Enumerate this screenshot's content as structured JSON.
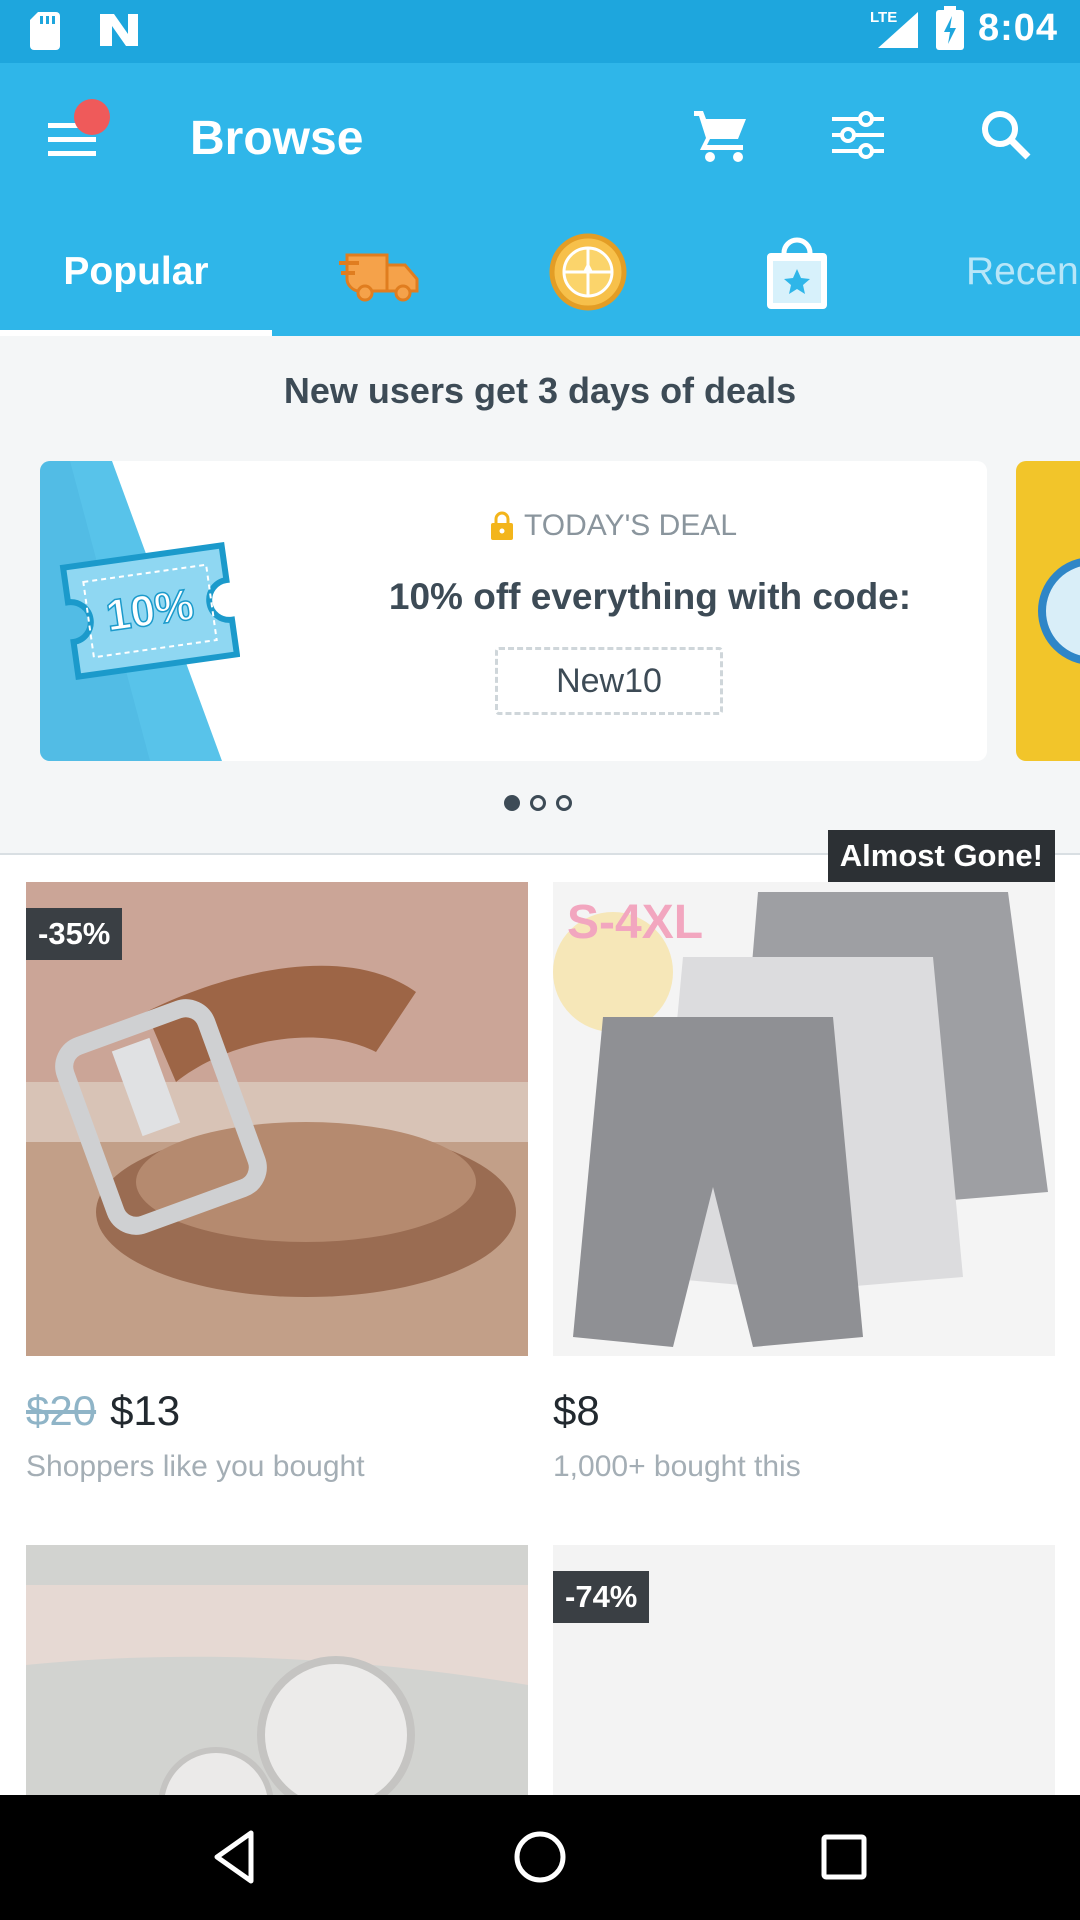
{
  "status_bar": {
    "time": "8:04",
    "network": "LTE"
  },
  "app_bar": {
    "title": "Browse"
  },
  "tabs": {
    "popular": "Popular",
    "recent": "Recen",
    "icons": [
      "delivery-truck-icon",
      "wheel-icon",
      "shopping-bag-icon"
    ]
  },
  "promo": {
    "heading": "New users get 3 days of deals",
    "kicker": "TODAY'S DEAL",
    "title": "10% off everything with code:",
    "code": "New10",
    "ticket_text": "10%",
    "carousel_total": 3,
    "carousel_active": 1
  },
  "products": [
    {
      "tag": "-35%",
      "old_price": "$20",
      "price": "$13",
      "subtitle": "Shoppers like you bought"
    },
    {
      "tag_text": "S-4XL",
      "badge": "Almost Gone!",
      "price": "$8",
      "subtitle": "1,000+ bought this"
    },
    {
      "tag": ""
    },
    {
      "tag": "-74%"
    }
  ],
  "colors": {
    "brand": "#2fb6e9",
    "statusbar": "#1ea6dd",
    "badge": "#ef5a5a"
  }
}
